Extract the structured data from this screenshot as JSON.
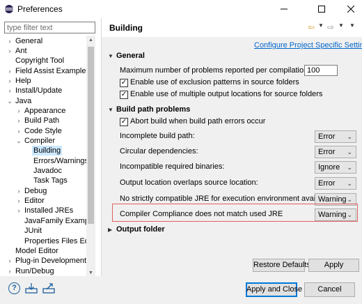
{
  "window": {
    "title": "Preferences",
    "minimize_glyph": "—",
    "maximize_glyph": "☐",
    "close_glyph": "✕"
  },
  "sidebar": {
    "filter_placeholder": "type filter text",
    "items": [
      {
        "label": "General",
        "arrow": "›",
        "level": 0
      },
      {
        "label": "Ant",
        "arrow": "›",
        "level": 0
      },
      {
        "label": "Copyright Tool",
        "arrow": "",
        "level": 0
      },
      {
        "label": "Field Assist Example Pref",
        "arrow": "›",
        "level": 0
      },
      {
        "label": "Help",
        "arrow": "›",
        "level": 0
      },
      {
        "label": "Install/Update",
        "arrow": "›",
        "level": 0
      },
      {
        "label": "Java",
        "arrow": "⌄",
        "level": 0
      },
      {
        "label": "Appearance",
        "arrow": "›",
        "level": 1
      },
      {
        "label": "Build Path",
        "arrow": "›",
        "level": 1
      },
      {
        "label": "Code Style",
        "arrow": "›",
        "level": 1
      },
      {
        "label": "Compiler",
        "arrow": "⌄",
        "level": 1
      },
      {
        "label": "Building",
        "arrow": "",
        "level": 2,
        "selected": true
      },
      {
        "label": "Errors/Warnings",
        "arrow": "",
        "level": 2
      },
      {
        "label": "Javadoc",
        "arrow": "",
        "level": 2
      },
      {
        "label": "Task Tags",
        "arrow": "",
        "level": 2
      },
      {
        "label": "Debug",
        "arrow": "›",
        "level": 1
      },
      {
        "label": "Editor",
        "arrow": "›",
        "level": 1
      },
      {
        "label": "Installed JREs",
        "arrow": "›",
        "level": 1
      },
      {
        "label": "JavaFamily Example",
        "arrow": "",
        "level": 1
      },
      {
        "label": "JUnit",
        "arrow": "",
        "level": 1
      },
      {
        "label": "Properties Files Editor",
        "arrow": "",
        "level": 1
      },
      {
        "label": "Model Editor",
        "arrow": "",
        "level": 0
      },
      {
        "label": "Plug-in Development",
        "arrow": "›",
        "level": 0
      },
      {
        "label": "Run/Debug",
        "arrow": "›",
        "level": 0
      }
    ]
  },
  "page": {
    "title": "Building",
    "configure_link": "Configure Project Specific Settings...",
    "general_section": {
      "title": "General",
      "max_problems_label": "Maximum number of problems reported per compilation unit:",
      "max_problems_value": "100",
      "exclusion_label": "Enable use of exclusion patterns in source folders",
      "exclusion_checked": true,
      "multiple_output_label": "Enable use of multiple output locations for source folders",
      "multiple_output_checked": true
    },
    "build_path_section": {
      "title": "Build path problems",
      "abort_label": "Abort build when build path errors occur",
      "abort_checked": true,
      "rows": [
        {
          "label": "Incomplete build path:",
          "value": "Error"
        },
        {
          "label": "Circular dependencies:",
          "value": "Error"
        },
        {
          "label": "Incompatible required binaries:",
          "value": "Ignore"
        },
        {
          "label": "Output location overlaps source location:",
          "value": "Error"
        },
        {
          "label": "No strictly compatible JRE for execution environment available:",
          "value": "Warning"
        },
        {
          "label": "Compiler Compliance does not match used JRE",
          "value": "Warning"
        }
      ]
    },
    "output_section": {
      "title": "Output folder"
    },
    "restore_defaults_label": "Restore Defaults",
    "apply_label": "Apply"
  },
  "footer": {
    "help_glyph": "?",
    "apply_close_label": "Apply and Close",
    "cancel_label": "Cancel"
  },
  "colors": {
    "link": "#0066cc",
    "selection": "#cce8ff",
    "highlight_border": "#e06060",
    "primary_border": "#0078d7"
  }
}
